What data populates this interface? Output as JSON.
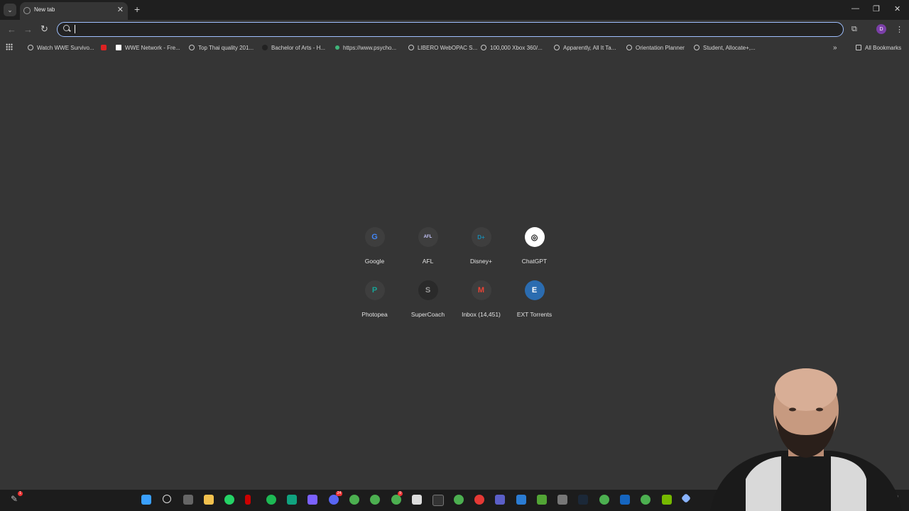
{
  "browser": {
    "tab_title": "New tab",
    "omnibox_value": "",
    "profile_initial": "D"
  },
  "bookmarks": [
    {
      "label": "Watch WWE Survivo...",
      "icon": "globe-icon"
    },
    {
      "label": "",
      "icon": "youtube-icon"
    },
    {
      "label": "WWE Network - Fre...",
      "icon": "wwe-icon"
    },
    {
      "label": "Top Thai quality 201...",
      "icon": "globe-icon"
    },
    {
      "label": "Bachelor of Arts - H...",
      "icon": "uni-icon"
    },
    {
      "label": "https://www.psycho...",
      "icon": "psych-icon"
    },
    {
      "label": "LIBERO WebOPAC S...",
      "icon": "globe-icon"
    },
    {
      "label": "100,000 Xbox 360/...",
      "icon": "globe-icon"
    },
    {
      "label": "Apparently, All It Ta...",
      "icon": "globe-icon"
    },
    {
      "label": "Orientation Planner",
      "icon": "globe-icon"
    },
    {
      "label": "Student, Allocate+,...",
      "icon": "globe-icon"
    }
  ],
  "all_bookmarks_label": "All Bookmarks",
  "shortcuts": [
    {
      "label": "Google",
      "glyph": "G",
      "color": "#4285f4"
    },
    {
      "label": "AFL",
      "glyph": "AFL",
      "color": "#c8c8ff"
    },
    {
      "label": "Disney+",
      "glyph": "D+",
      "color": "#1a8ab0"
    },
    {
      "label": "ChatGPT",
      "glyph": "◎",
      "color": "#ffffff"
    },
    {
      "label": "Photopea",
      "glyph": "P",
      "color": "#18a497"
    },
    {
      "label": "SuperCoach",
      "glyph": "S",
      "color": "#111111"
    },
    {
      "label": "Inbox (14,451)",
      "glyph": "M",
      "color": "#ea4335"
    },
    {
      "label": "EXT Torrents",
      "glyph": "E",
      "color": "#1e88e5"
    }
  ],
  "taskbar_badges": {
    "notifications": "1",
    "messenger": "24",
    "edge": "9"
  },
  "colors": {
    "background": "#353535",
    "tabbar": "#1f1f1f",
    "omnibox_focus": "#9fc0ff",
    "taskbar": "#1c1c1c"
  }
}
